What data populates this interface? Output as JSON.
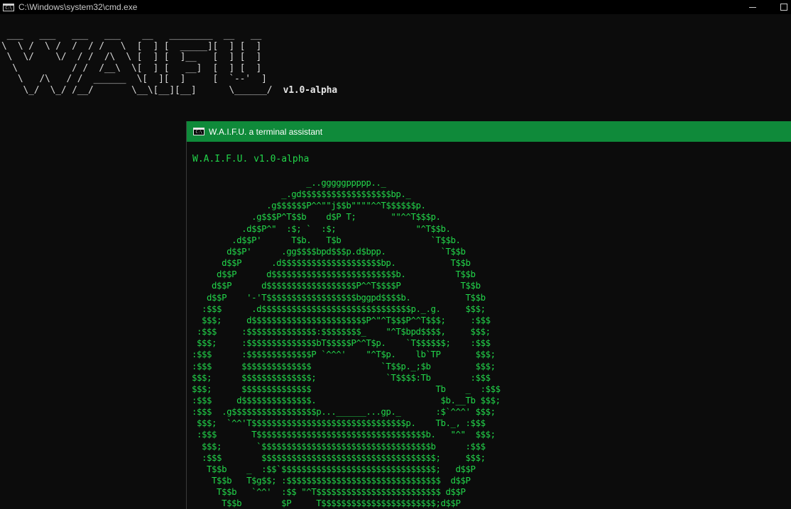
{
  "outer_window": {
    "title": "C:\\Windows\\system32\\cmd.exe",
    "icon": "cmd-icon",
    "icon_text": "C:\\"
  },
  "banner": {
    "ascii": " ___   ___   ___   ___    __   ________  __   __\n\\  \\ /  \\ /  /  / /   \\  [  ] [  _____][  ] [  ]\n \\  \\/    \\/  / /  /\\  \\ [  ] [  ]__   [  ] [  ]\n  \\          / /  /__\\  \\[  ] [   __]  [  ] [  ]\n   \\   /\\   / /  ______  \\[  ][  ]     [  `--'  ]\n    \\_/  \\_/ /__/       \\__\\[__][__]      \\______/",
    "version": "v1.0-alpha"
  },
  "assistant_window": {
    "title": "W.A.I.F.U. a terminal assistant",
    "icon": "cmd-icon",
    "icon_text": "C:\\",
    "accent_color": "#0f8a3a",
    "text_color": "#22d64a",
    "heading": "W.A.I.F.U. v1.0-alpha",
    "ascii_art": "                        _..gggggppppp.._\n                   _.gd$$$$$$$$$$$$$$$$$$bp._\n                .g$$$$$$P^^\"\"j$$b\"\"\"\"^^T$$$$$$p.\n             .g$$$P^T$$b    d$P T;       \"\"^^T$$$p.\n           .d$$P^\"  :$; `  :$;                \"^T$$b.\n         .d$$P'      T$b.   T$b                  `T$$b.\n        d$$P'      .gg$$$$bpd$$$p.d$bpp.           `T$$b\n       d$$P      .d$$$$$$$$$$$$$$$$$$$$bp.           T$$b\n      d$$P      d$$$$$$$$$$$$$$$$$$$$$$$$$b.          T$$b\n     d$$P      d$$$$$$$$$$$$$$$$$$P^^T$$$$P            T$$b\n    d$$P    '-'T$$$$$$$$$$$$$$$$$$bggpd$$$$b.           T$$b\n   :$$$      .d$$$$$$$$$$$$$$$$$$$$$$$$$$$$$$p._.g.     $$$;\n   $$$;     d$$$$$$$$$$$$$$$$$$$$$$$P^\"^T$$$P^^T$$$;     :$$$\n  :$$$     :$$$$$$$$$$$$$$:$$$$$$$$_    \"^T$bpd$$$$,     $$$;\n  $$$;     :$$$$$$$$$$$$$$bT$$$$$P^^T$p.    `T$$$$$$;    :$$$\n :$$$      :$$$$$$$$$$$$$P `^^^'    \"^T$p.    lb`TP       $$$;\n :$$$      $$$$$$$$$$$$$$              `T$$p._;$b         $$$;\n $$$;      $$$$$$$$$$$$$$;              `T$$$$:Tb        :$$$\n $$$;      $$$$$$$$$$$$$$                         Tb    _  :$$$\n :$$$     d$$$$$$$$$$$$$$.                         $b.__Tb $$$;\n :$$$  .g$$$$$$$$$$$$$$$$$p...______...gp._       :$`^^^' $$$;\n  $$$;  `^^'T$$$$$$$$$$$$$$$$$$$$$$$$$$$$$$$p.    Tb._, :$$$\n  :$$$       T$$$$$$$$$$$$$$$$$$$$$$$$$$$$$$$$$$b.   \"^\"  $$$;\n   $$$;       `$$$$$$$$$$$$$$$$$$$$$$$$$$$$$$$$$$b      :$$$\n   :$$$        $$$$$$$$$$$$$$$$$$$$$$$$$$$$$$$$$$$;     $$$;\n    T$$b    _  :$$`$$$$$$$$$$$$$$$$$$$$$$$$$$$$$$$;   d$$P\n     T$$b   T$g$$; :$$$$$$$$$$$$$$$$$$$$$$$$$$$$$$$  d$$P\n      T$$b   `^^'  :$$ \"^T$$$$$$$$$$$$$$$$$$$$$$$$$ d$$P\n       T$$b        $P     T$$$$$$$$$$$$$$$$$$$$$$$;d$$P\n        T$$b.       '       $$$$$$$$$$$$$$$$$$$$$$$$$$P"
  }
}
